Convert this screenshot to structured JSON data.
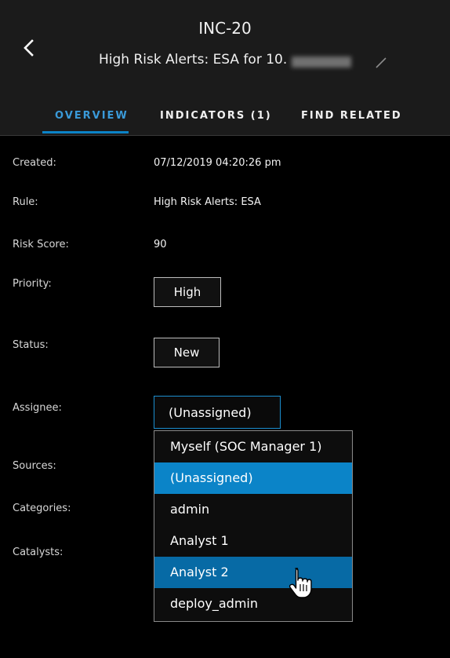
{
  "header": {
    "incident_id": "INC-20",
    "title": "High Risk Alerts: ESA for 10."
  },
  "tabs": [
    {
      "label": "OVERVIEW",
      "active": true
    },
    {
      "label": "INDICATORS (1)",
      "active": false
    },
    {
      "label": "FIND RELATED",
      "active": false
    }
  ],
  "fields": {
    "created": {
      "label": "Created:",
      "value": "07/12/2019 04:20:26 pm"
    },
    "rule": {
      "label": "Rule:",
      "value": "High Risk Alerts: ESA"
    },
    "risk_score": {
      "label": "Risk Score:",
      "value": "90"
    },
    "priority": {
      "label": "Priority:",
      "value": "High"
    },
    "status": {
      "label": "Status:",
      "value": "New"
    },
    "assignee": {
      "label": "Assignee:",
      "value": "(Unassigned)"
    },
    "sources": {
      "label": "Sources:"
    },
    "categories": {
      "label": "Categories:"
    },
    "catalysts": {
      "label": "Catalysts:"
    }
  },
  "assignee_dropdown": {
    "options": [
      "Myself (SOC Manager 1)",
      "(Unassigned)",
      "admin",
      "Analyst 1",
      "Analyst 2",
      "deploy_admin"
    ],
    "selected": "(Unassigned)",
    "hovered": "Analyst 2"
  },
  "colors": {
    "accent": "#0b84c8",
    "hover": "#076aa5",
    "background": "#000000",
    "header_bg": "#1b1b1b"
  },
  "icons": {
    "back": "chevron-left-icon",
    "edit": "pencil-icon",
    "cursor": "hand-pointer-icon"
  }
}
